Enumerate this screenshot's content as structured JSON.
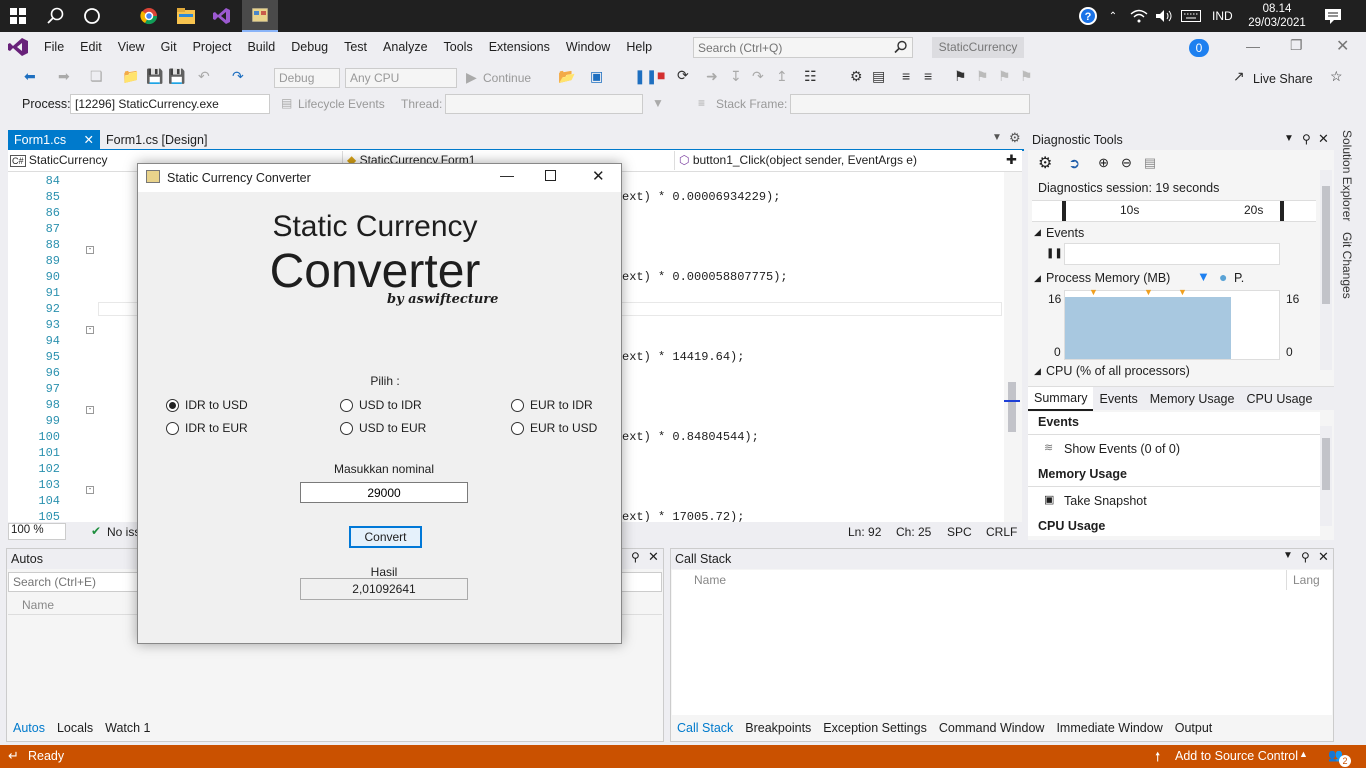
{
  "taskbar": {
    "clock_time": "08.14",
    "clock_date": "29/03/2021",
    "lang": "IND"
  },
  "menu": [
    "File",
    "Edit",
    "View",
    "Git",
    "Project",
    "Build",
    "Debug",
    "Test",
    "Analyze",
    "Tools",
    "Extensions",
    "Window",
    "Help"
  ],
  "search": {
    "placeholder": "Search (Ctrl+Q)"
  },
  "solution_title": "StaticCurrency",
  "notif_count": "0",
  "toolbar": {
    "config": "Debug",
    "platform": "Any CPU",
    "continue": "Continue",
    "live_share": "Live Share"
  },
  "toolbar2": {
    "process_label": "Process:",
    "process_value": "[12296] StaticCurrency.exe",
    "lifecycle": "Lifecycle Events",
    "thread_label": "Thread:",
    "stack_label": "Stack Frame:"
  },
  "tabs": [
    {
      "label": "Form1.cs",
      "active": true
    },
    {
      "label": "Form1.cs [Design]",
      "active": false
    }
  ],
  "nav": {
    "project": "StaticCurrency",
    "class": "StaticCurrency.Form1",
    "member": "button1_Click(object sender, EventArgs e)"
  },
  "lines": [
    "84",
    "85",
    "86",
    "87",
    "88",
    "89",
    "90",
    "91",
    "92",
    "93",
    "94",
    "95",
    "96",
    "97",
    "98",
    "99",
    "100",
    "101",
    "102",
    "103",
    "104",
    "105"
  ],
  "code": {
    "l85": "ext) * 0.00006934229);",
    "l90": "ext) * 0.000058807775);",
    "l95": "ext) * 14419.64);",
    "l100": "ext) * 0.84804544);",
    "l105": "ext) * 17005.72);"
  },
  "editor_status": {
    "zoom": "100 %",
    "issues": "No iss",
    "ln": "Ln: 92",
    "ch": "Ch: 25",
    "spc": "SPC",
    "crlf": "CRLF"
  },
  "autos": {
    "title": "Autos",
    "search_placeholder": "Search (Ctrl+E)",
    "col_name": "Name",
    "tabs": [
      "Autos",
      "Locals",
      "Watch 1"
    ]
  },
  "callstack": {
    "title": "Call Stack",
    "col_name": "Name",
    "col_lang": "Lang",
    "tabs": [
      "Call Stack",
      "Breakpoints",
      "Exception Settings",
      "Command Window",
      "Immediate Window",
      "Output"
    ]
  },
  "diag": {
    "title": "Diagnostic Tools",
    "session": "Diagnostics session: 19 seconds",
    "t10": "10s",
    "t20": "20s",
    "events": "Events",
    "proc_mem": "Process Memory (MB)",
    "p_legend": "P.",
    "mem_max": "16",
    "mem_min": "0",
    "cpu": "CPU (% of all processors)",
    "subtabs": [
      "Summary",
      "Events",
      "Memory Usage",
      "CPU Usage"
    ],
    "sum_events": "Events",
    "show_events": "Show Events (0 of 0)",
    "mem_usage": "Memory Usage",
    "take_snapshot": "Take Snapshot",
    "cpu_usage": "CPU Usage"
  },
  "side": {
    "solution_explorer": "Solution Explorer",
    "git_changes": "Git Changes"
  },
  "dialog": {
    "title": "Static Currency Converter",
    "heading1": "Static Currency",
    "heading2": "Converter",
    "byline": "by aswiftecture",
    "pilih": "Pilih :",
    "radios": [
      "IDR to USD",
      "USD to IDR",
      "EUR to IDR",
      "IDR to EUR",
      "USD to EUR",
      "EUR to USD"
    ],
    "nominal_label": "Masukkan nominal",
    "nominal_value": "29000",
    "convert": "Convert",
    "hasil_label": "Hasil",
    "hasil_value": "2,01092641"
  },
  "status": {
    "ready": "Ready",
    "source_control": "Add to Source Control",
    "notif": "2"
  }
}
